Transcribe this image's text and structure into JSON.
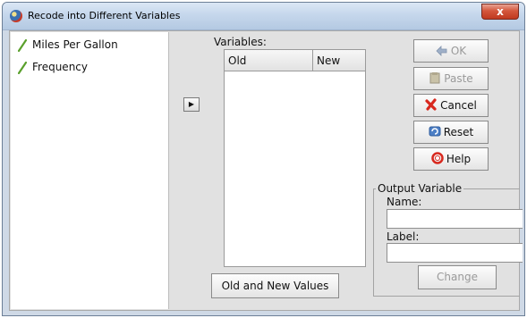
{
  "window": {
    "title": "Recode into Different Variables",
    "close_label": "x"
  },
  "source_variables": [
    {
      "label": "Miles Per Gallon",
      "icon": "scale-variable-icon"
    },
    {
      "label": "Frequency",
      "icon": "scale-variable-icon"
    }
  ],
  "move_button": {
    "icon": "right-arrow-icon",
    "glyph": "▶"
  },
  "variables_panel": {
    "label": "Variables:",
    "columns": [
      "Old",
      "New"
    ],
    "rows": []
  },
  "buttons": {
    "ok": {
      "label": "OK",
      "enabled": false,
      "icon": "ok-arrow-icon"
    },
    "paste": {
      "label": "Paste",
      "enabled": false,
      "icon": "clipboard-icon"
    },
    "cancel": {
      "label": "Cancel",
      "enabled": true,
      "icon": "cancel-x-icon"
    },
    "reset": {
      "label": "Reset",
      "enabled": true,
      "icon": "reset-icon"
    },
    "help": {
      "label": "Help",
      "enabled": true,
      "icon": "help-lifebuoy-icon"
    },
    "old_new": {
      "label": "Old and New Values"
    }
  },
  "output_variable": {
    "title": "Output Variable",
    "name_label": "Name:",
    "name_value": "",
    "label_label": "Label:",
    "label_value": "",
    "change_label": "Change",
    "change_enabled": false
  },
  "colors": {
    "title_bar": "#c5d7ec",
    "client_bg": "#e1e1e1",
    "close_red": "#c0391f",
    "variable_icon_green": "#5aa02c"
  }
}
